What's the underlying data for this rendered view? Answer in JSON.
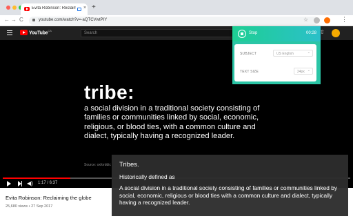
{
  "browser": {
    "tab_title": "Evita Robinson: Reclaimin",
    "tab_close": "×",
    "new_tab": "+",
    "url": "youtube.com/watch?v=-aQTCVwtPIY",
    "star": "☆",
    "menu": "⋮",
    "nav_back": "←",
    "nav_forward": "→",
    "nav_reload": "C"
  },
  "youtube": {
    "logo": "YouTube",
    "logo_region": "CA",
    "search_placeholder": "Search",
    "upload_icon": "⇧"
  },
  "video": {
    "word": "tribe:",
    "definition": "a social division in a traditional society consisting of families or communities linked by social, economic, religious, or blood ties, with a common culture and dialect, typically having a recognized leader.",
    "source": "Source: oxforddic",
    "time": "1:17 / 6:37",
    "progress_fraction": 0.194,
    "volume_icon": "◀)"
  },
  "video_info": {
    "title": "Evita Robinson: Reclaiming the globe",
    "meta": "25,680 views • 27 Sep 2017"
  },
  "extension": {
    "stop_label": "Stop",
    "timer": "00:28",
    "subject_label": "SUBJECT",
    "subject_value": "US English",
    "text_size_label": "TEXT SIZE",
    "text_size_value": "24px",
    "chevron": "⌄",
    "accent_color": "#1ecf93"
  },
  "caption": {
    "term": "Tribes.",
    "subtitle": "Historically defined as",
    "definition": "A social division in a traditional society consisting of families or communities linked by social, economic, religious or blood ties with a common culture and dialect, typically having a recognized leader."
  }
}
